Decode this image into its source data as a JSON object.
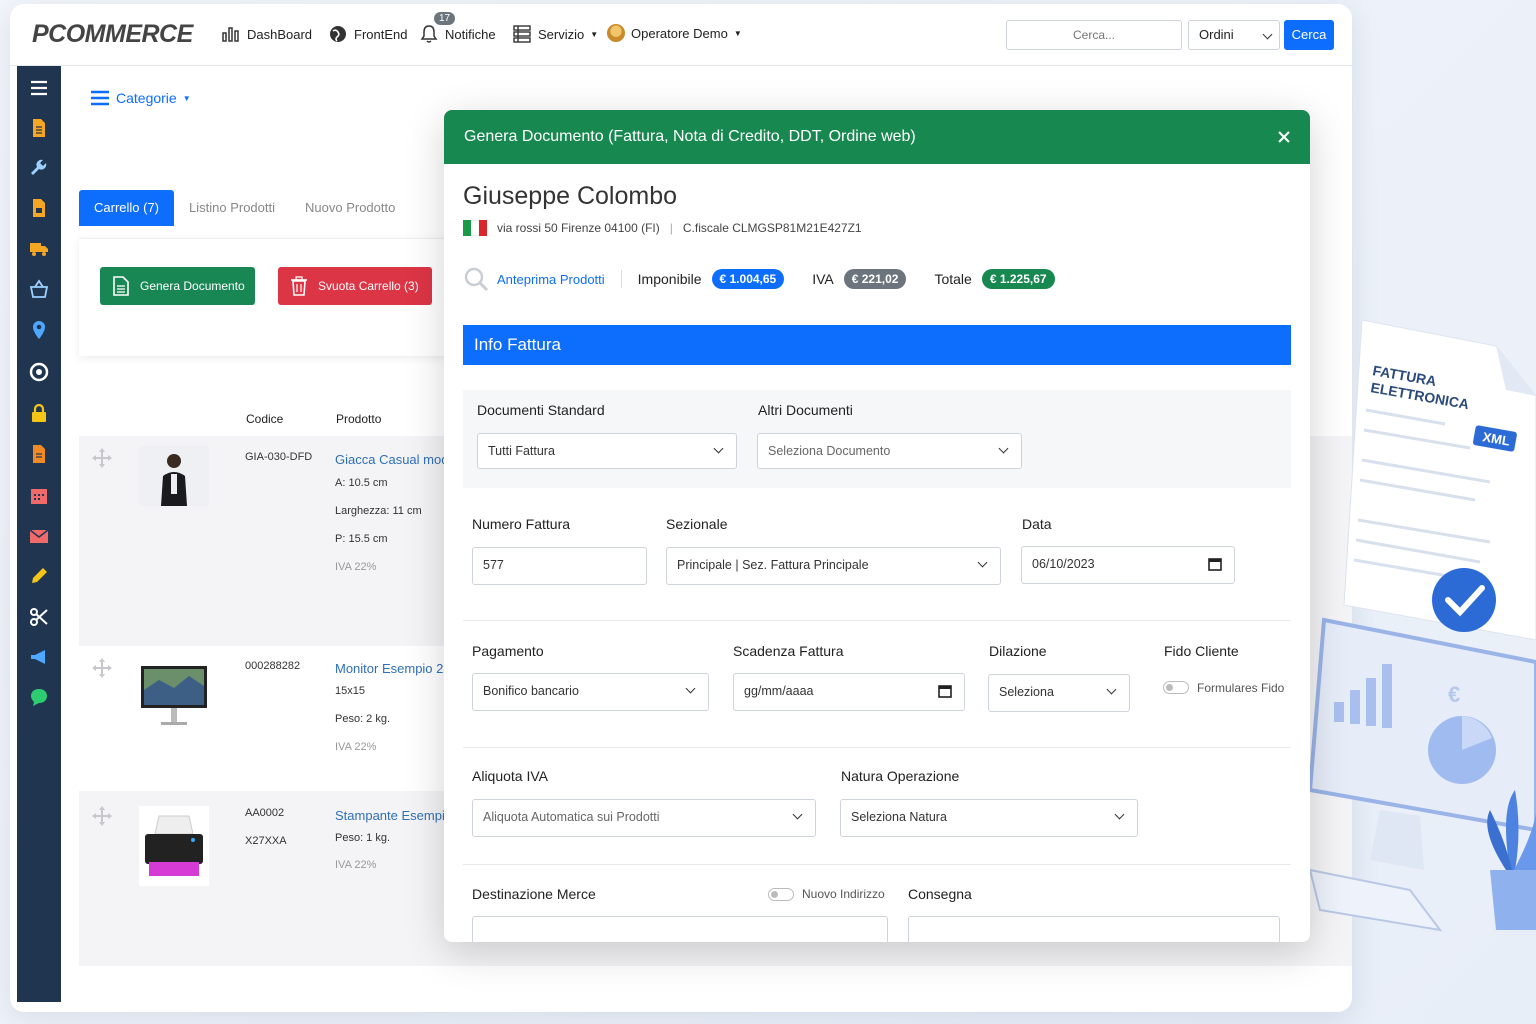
{
  "app": {
    "logo": "PCOMMERCE",
    "nav": {
      "dashboard": "DashBoard",
      "frontend": "FrontEnd",
      "notifiche": "Notifiche",
      "notifiche_count": "17",
      "servizio": "Servizio",
      "operatore": "Operatore Demo"
    },
    "search": {
      "placeholder": "Cerca...",
      "type_selected": "Ordini",
      "button": "Cerca"
    }
  },
  "page": {
    "categorie": "Categorie",
    "tabs": [
      "Carrello (7)",
      "Listino Prodotti",
      "Nuovo Prodotto"
    ],
    "cart": {
      "genera": "Genera Documento",
      "svuota": "Svuota Carrello (3)"
    },
    "columns": {
      "codice": "Codice",
      "prodotto": "Prodotto"
    },
    "products": [
      {
        "code": "GIA-030-DFD",
        "code2": "",
        "name": "Giacca Casual mod",
        "attrs": [
          "A: 10.5 cm",
          "Larghezza: 11 cm",
          "P: 15.5 cm"
        ],
        "iva": "IVA 22%"
      },
      {
        "code": "000288282",
        "code2": "",
        "name": "Monitor Esempio 2",
        "attrs": [
          "15x15",
          "Peso: 2 kg."
        ],
        "iva": "IVA 22%"
      },
      {
        "code": "AA0002",
        "code2": "X27XXA",
        "name": "Stampante Esempi",
        "attrs": [
          "Peso: 1 kg."
        ],
        "iva": "IVA 22%"
      }
    ]
  },
  "modal": {
    "title": "Genera Documento (Fattura, Nota di Credito, DDT, Ordine web)",
    "customer": {
      "name": "Giuseppe Colombo",
      "address": "via rossi 50 Firenze 04100 (FI)",
      "separator": "|",
      "cf": "C.fiscale CLMGSP81M21E427Z1"
    },
    "totals": {
      "anteprima": "Anteprima Prodotti",
      "imponibile_label": "Imponibile",
      "imponibile": "€ 1.004,65",
      "iva_label": "IVA",
      "iva": "€ 221,02",
      "totale_label": "Totale",
      "totale": "€ 1.225,67"
    },
    "section_title": "Info Fattura",
    "fields": {
      "doc_standard_label": "Documenti Standard",
      "doc_standard_value": "Tutti Fattura",
      "altri_doc_label": "Altri Documenti",
      "altri_doc_value": "Seleziona Documento",
      "numero_label": "Numero Fattura",
      "numero_value": "577",
      "sezionale_label": "Sezionale",
      "sezionale_value": "Principale | Sez. Fattura Principale",
      "data_label": "Data",
      "data_value": "06/10/2023",
      "pagamento_label": "Pagamento",
      "pagamento_value": "Bonifico bancario",
      "scadenza_label": "Scadenza Fattura",
      "scadenza_value": "gg/mm/aaaa",
      "dilazione_label": "Dilazione",
      "dilazione_value": "Seleziona",
      "fido_label": "Fido Cliente",
      "fido_toggle": "Formulares Fido",
      "aliquota_label": "Aliquota IVA",
      "aliquota_value": "Aliquota Automatica sui Prodotti",
      "natura_label": "Natura Operazione",
      "natura_value": "Seleziona Natura",
      "destinazione_label": "Destinazione Merce",
      "nuovo_indirizzo": "Nuovo Indirizzo",
      "consegna_label": "Consegna"
    }
  },
  "illustration": {
    "doc_title_1": "FATTURA",
    "doc_title_2": "ELETTRONICA",
    "badge": "XML",
    "currency": "€"
  },
  "colors": {
    "primary": "#0d6efd",
    "success": "#17884f",
    "danger": "#dc3545",
    "sidebar": "#1f3550",
    "iva_pill": "#6c757d"
  }
}
